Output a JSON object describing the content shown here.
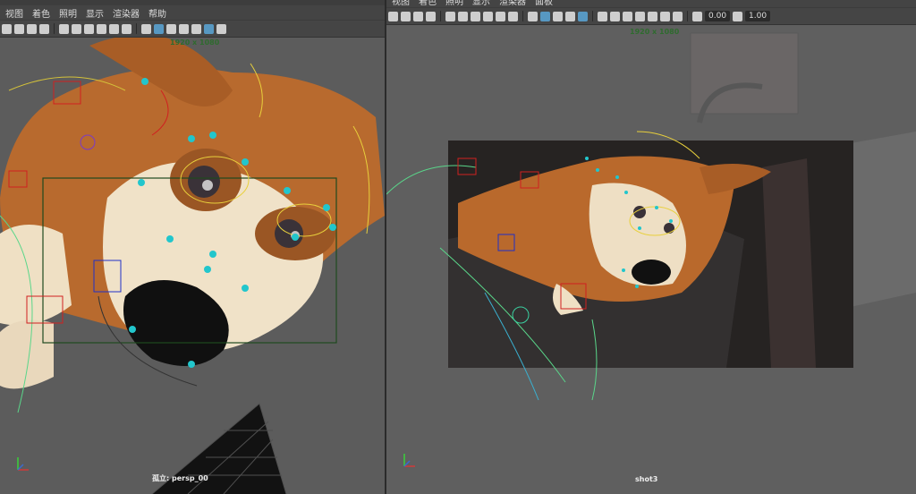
{
  "left_panel": {
    "menu": [
      "视图",
      "着色",
      "照明",
      "显示",
      "渲染器",
      "帮助"
    ],
    "toolbar_icons": [
      "select-camera-icon",
      "camera-attributes-icon",
      "bookmark-icon",
      "image-plane-icon",
      "grid-icon",
      "film-gate-icon",
      "resolution-gate-icon",
      "gate-mask-icon",
      "field-chart-icon",
      "safe-action-icon",
      "wireframe-icon",
      "smooth-shade-icon",
      "textured-icon",
      "lights-icon",
      "shadows-icon",
      "xray-icon",
      "isolate-icon"
    ],
    "resolution_label": "1920 x 1080",
    "camera_label": "孤立: persp_00"
  },
  "right_panel": {
    "menu": [
      "视图",
      "着色",
      "照明",
      "显示",
      "渲染器",
      "面板"
    ],
    "toolbar_icons": [
      "select-camera-icon",
      "camera-attributes-icon",
      "bookmark-icon",
      "image-plane-icon",
      "grid-icon",
      "film-gate-icon",
      "resolution-gate-icon",
      "gate-mask-icon",
      "field-chart-icon",
      "safe-action-icon",
      "wireframe-icon",
      "smooth-shade-icon",
      "textured-icon",
      "lights-icon",
      "shadows-icon",
      "xray-icon",
      "isolate-icon",
      "exposure-icon",
      "gamma-icon"
    ],
    "exposure_value": "0.00",
    "gamma_value": "1.00",
    "resolution_label": "1920 x 1080",
    "camera_label": "shot3"
  }
}
